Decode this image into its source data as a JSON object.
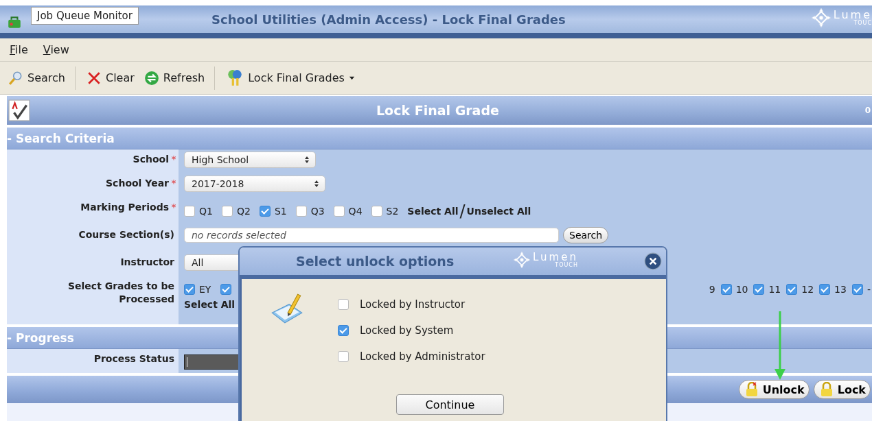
{
  "window": {
    "title": "School Utilities (Admin Access) - Lock Final Grades",
    "logo": {
      "word": "Lume",
      "tagline": "TOUC"
    }
  },
  "tooltip": "Job Queue Monitor",
  "menu": [
    {
      "label": "File"
    },
    {
      "label": "View"
    }
  ],
  "toolbar": [
    {
      "kind": "search",
      "label": "Search"
    },
    {
      "kind": "separator"
    },
    {
      "kind": "clear",
      "label": "Clear"
    },
    {
      "kind": "refresh",
      "label": "Refresh"
    },
    {
      "kind": "separator"
    },
    {
      "kind": "keys",
      "label": "Lock Final Grades",
      "has_menu": true
    }
  ],
  "panel": {
    "title": "Lock Final Grade",
    "corner": "0"
  },
  "search_criteria": {
    "title": "- Search Criteria",
    "fields": [
      {
        "kind": "select",
        "label": "School",
        "required_mark": "*",
        "value": "High School"
      },
      {
        "kind": "select",
        "label": "School Year",
        "required_mark": "*",
        "value": "2017-2018"
      },
      {
        "kind": "checks",
        "label": "Marking Periods",
        "required_mark": "*",
        "options": [
          {
            "label": "Q1",
            "checked": false
          },
          {
            "label": "Q2",
            "checked": false
          },
          {
            "label": "S1",
            "checked": true
          },
          {
            "label": "Q3",
            "checked": false
          },
          {
            "label": "Q4",
            "checked": false
          },
          {
            "label": "S2",
            "checked": false
          }
        ],
        "select_all": "Select All",
        "divider": "/",
        "unselect_all": "Unselect All"
      },
      {
        "kind": "lookup",
        "label": "Course Section(s)",
        "placeholder": "no records selected",
        "button": "Search"
      },
      {
        "kind": "select_cut",
        "label": "Instructor",
        "value": "All"
      },
      {
        "kind": "grades",
        "label": "Select Grades to be Processed",
        "options_left": [
          {
            "label": "EY",
            "checked": true
          },
          {
            "checked": true
          }
        ],
        "options_right": [
          {
            "label": "9"
          },
          {
            "label": "10",
            "checked": true
          },
          {
            "label": "11",
            "checked": true
          },
          {
            "label": "12",
            "checked": true
          },
          {
            "label": "13",
            "checked": true
          },
          {
            "label": "-",
            "checked": true
          }
        ],
        "select_all": "Select All"
      }
    ]
  },
  "progress": {
    "title": "- Progress",
    "status_label": "Process Status"
  },
  "footer_buttons": [
    {
      "kind": "unlock",
      "label": "Unlock"
    },
    {
      "kind": "lock",
      "label": "Lock"
    }
  ],
  "dialog": {
    "title": "Select unlock options",
    "logo": {
      "word": "Lumen",
      "tagline": "TOUCH"
    },
    "options": [
      {
        "label": "Locked by Instructor",
        "checked": false
      },
      {
        "label": "Locked by System",
        "checked": true
      },
      {
        "label": "Locked by Administrator",
        "checked": false
      }
    ],
    "button": "Continue"
  }
}
